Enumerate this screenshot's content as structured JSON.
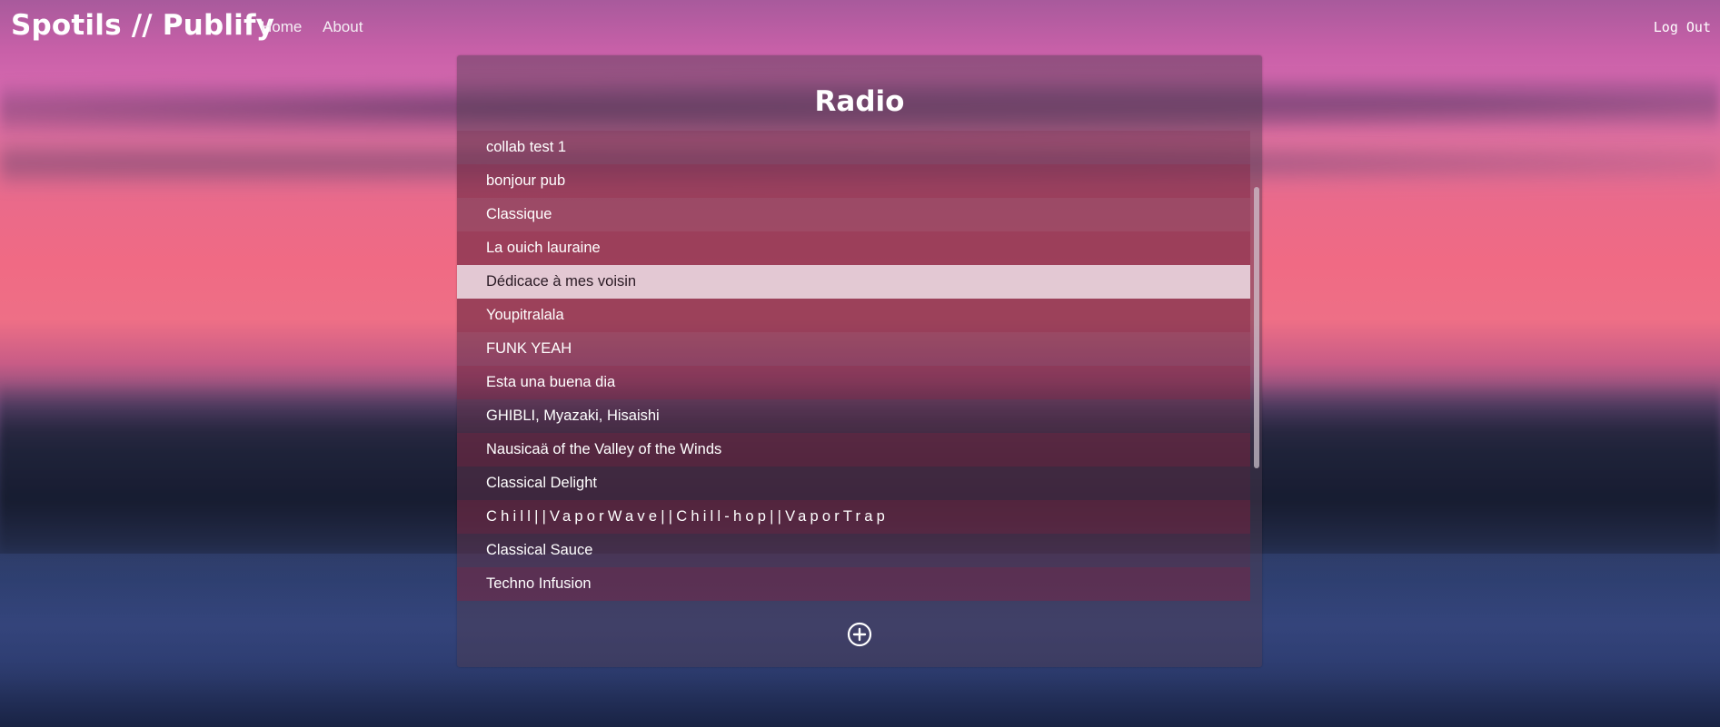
{
  "header": {
    "brand": "Spotils // Publify",
    "nav": [
      {
        "label": "Home"
      },
      {
        "label": "About"
      }
    ],
    "logout_label": "Log Out"
  },
  "panel": {
    "title": "Radio",
    "selected_index": 4,
    "items": [
      {
        "label": "collab test 1"
      },
      {
        "label": "bonjour pub"
      },
      {
        "label": "Classique"
      },
      {
        "label": "La ouich lauraine"
      },
      {
        "label": "Dédicace à mes voisin"
      },
      {
        "label": "Youpitralala"
      },
      {
        "label": "FUNK YEAH"
      },
      {
        "label": "Esta una buena dia"
      },
      {
        "label": "GHIBLI, Myazaki, Hisaishi"
      },
      {
        "label": "Nausicaä of the Valley of the Winds"
      },
      {
        "label": "Classical Delight"
      },
      {
        "label": "Chill||VaporWave||Chill-hop||VaporTrap"
      },
      {
        "label": "Classical Sauce"
      },
      {
        "label": "Techno Infusion"
      }
    ],
    "add_icon": "plus-circle-icon"
  },
  "colors": {
    "selected_row_bg": "#e8d2dc",
    "selected_row_text": "#2a1a24",
    "text": "#ffffff"
  }
}
